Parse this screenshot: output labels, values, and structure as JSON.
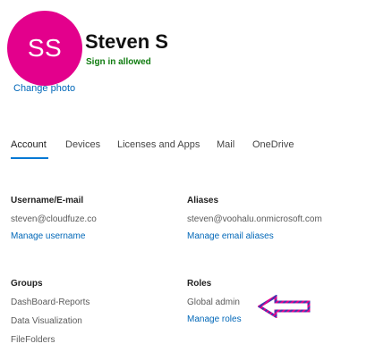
{
  "profile": {
    "initials": "SS",
    "avatar_color": "#e3008c",
    "name": "Steven S",
    "status": "Sign in allowed",
    "status_color": "#107c10",
    "change_photo": "Change photo"
  },
  "tabs": [
    {
      "label": "Account",
      "active": true
    },
    {
      "label": "Devices"
    },
    {
      "label": "Licenses and Apps"
    },
    {
      "label": "Mail"
    },
    {
      "label": "OneDrive"
    }
  ],
  "account": {
    "username": {
      "label": "Username/E-mail",
      "value": "steven@cloudfuze.co",
      "link": "Manage username"
    },
    "aliases": {
      "label": "Aliases",
      "value": "steven@voohalu.onmicrosoft.com",
      "link": "Manage email aliases"
    },
    "groups": {
      "label": "Groups",
      "items": [
        "DashBoard-Reports",
        "Data Visualization",
        "FileFolders"
      ]
    },
    "roles": {
      "label": "Roles",
      "value": "Global admin",
      "link": "Manage roles"
    }
  },
  "annotation": {
    "icon": "arrow-left-icon",
    "colors": [
      "#e3008c",
      "#3b3bb0"
    ]
  }
}
